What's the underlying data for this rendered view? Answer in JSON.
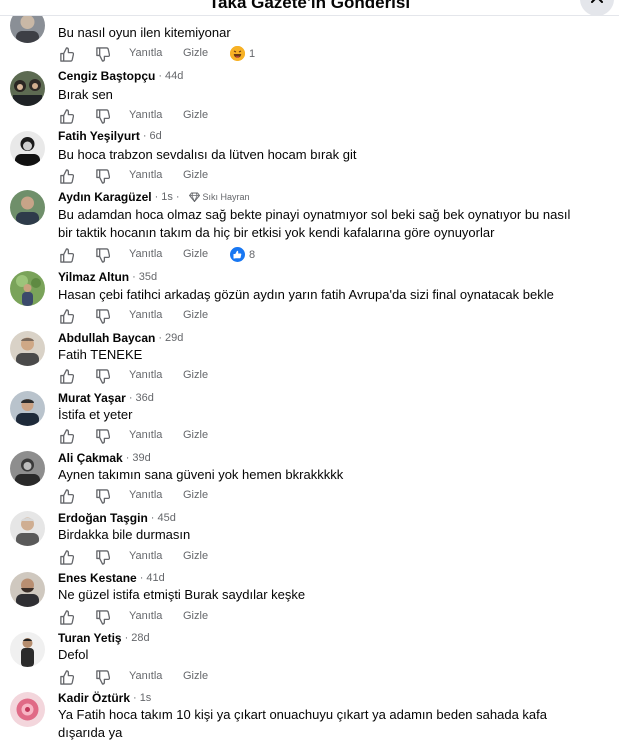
{
  "header": {
    "title": "Taka Gazete'in Gönderisi",
    "close_icon": "close-icon"
  },
  "actions": {
    "like_icon": "thumbs-up-icon",
    "dislike_icon": "thumbs-down-icon",
    "reply": "Yanıtla",
    "hide": "Gizle"
  },
  "top_partial": {
    "text": "Bu nasıl oyun ilen kitemiyonar",
    "reaction_icon": "haha-emoji-icon",
    "reaction_count": "1"
  },
  "comments": [
    {
      "author": "Cengiz Baştopçu",
      "time": "44d",
      "text": [
        "Bırak sen"
      ]
    },
    {
      "author": "Fatih Yeşilyurt",
      "time": "6d",
      "text": [
        "Bu hoca trabzon sevdalısı da lütven hocam bırak git"
      ]
    },
    {
      "author": "Aydın Karagüzel",
      "time": "1s",
      "badge": "Sıkı Hayran",
      "badge_icon": "diamond-icon",
      "text": [
        "Bu adamdan hoca olmaz sağ bekte pinayi oynatmıyor sol beki sağ bek oynatıyor bu nasıl",
        "bir taktik hocanın takım da hiç bir etkisi yok kendi kafalarına göre oynuyorlar"
      ],
      "reaction_icon": "like-reaction-icon",
      "reaction_count": "8"
    },
    {
      "author": "Yilmaz Altun",
      "time": "35d",
      "text": [
        "Hasan çebi fatihci arkadaş gözün aydın yarın fatih Avrupa'da sizi final oynatacak bekle"
      ]
    },
    {
      "author": "Abdullah Baycan",
      "time": "29d",
      "text": [
        "Fatih TENEKE"
      ]
    },
    {
      "author": "Murat Yaşar",
      "time": "36d",
      "text": [
        "İstifa et yeter"
      ]
    },
    {
      "author": "Ali Çakmak",
      "time": "39d",
      "text": [
        "Aynen takımın sana güveni yok hemen bkrakkkkk"
      ]
    },
    {
      "author": "Erdoğan Taşgin",
      "time": "45d",
      "text": [
        "Birdakka bile durmasın"
      ]
    },
    {
      "author": "Enes Kestane",
      "time": "41d",
      "text": [
        "Ne güzel istifa etmişti Burak saydılar keşke"
      ]
    },
    {
      "author": "Turan Yetiş",
      "time": "28d",
      "text": [
        "Defol"
      ]
    },
    {
      "author": "Kadir Öztürk",
      "time": "1s",
      "text": [
        "Ya Fatih hoca takım 10 kişi ya çıkart onuachuyu çıkart ya adamın beden sahada kafa",
        "dışarıda ya"
      ]
    }
  ],
  "colors": {
    "secondary_text": "#65676b",
    "like_blue": "#1877f2",
    "haha_yellow": "#f7b125"
  }
}
